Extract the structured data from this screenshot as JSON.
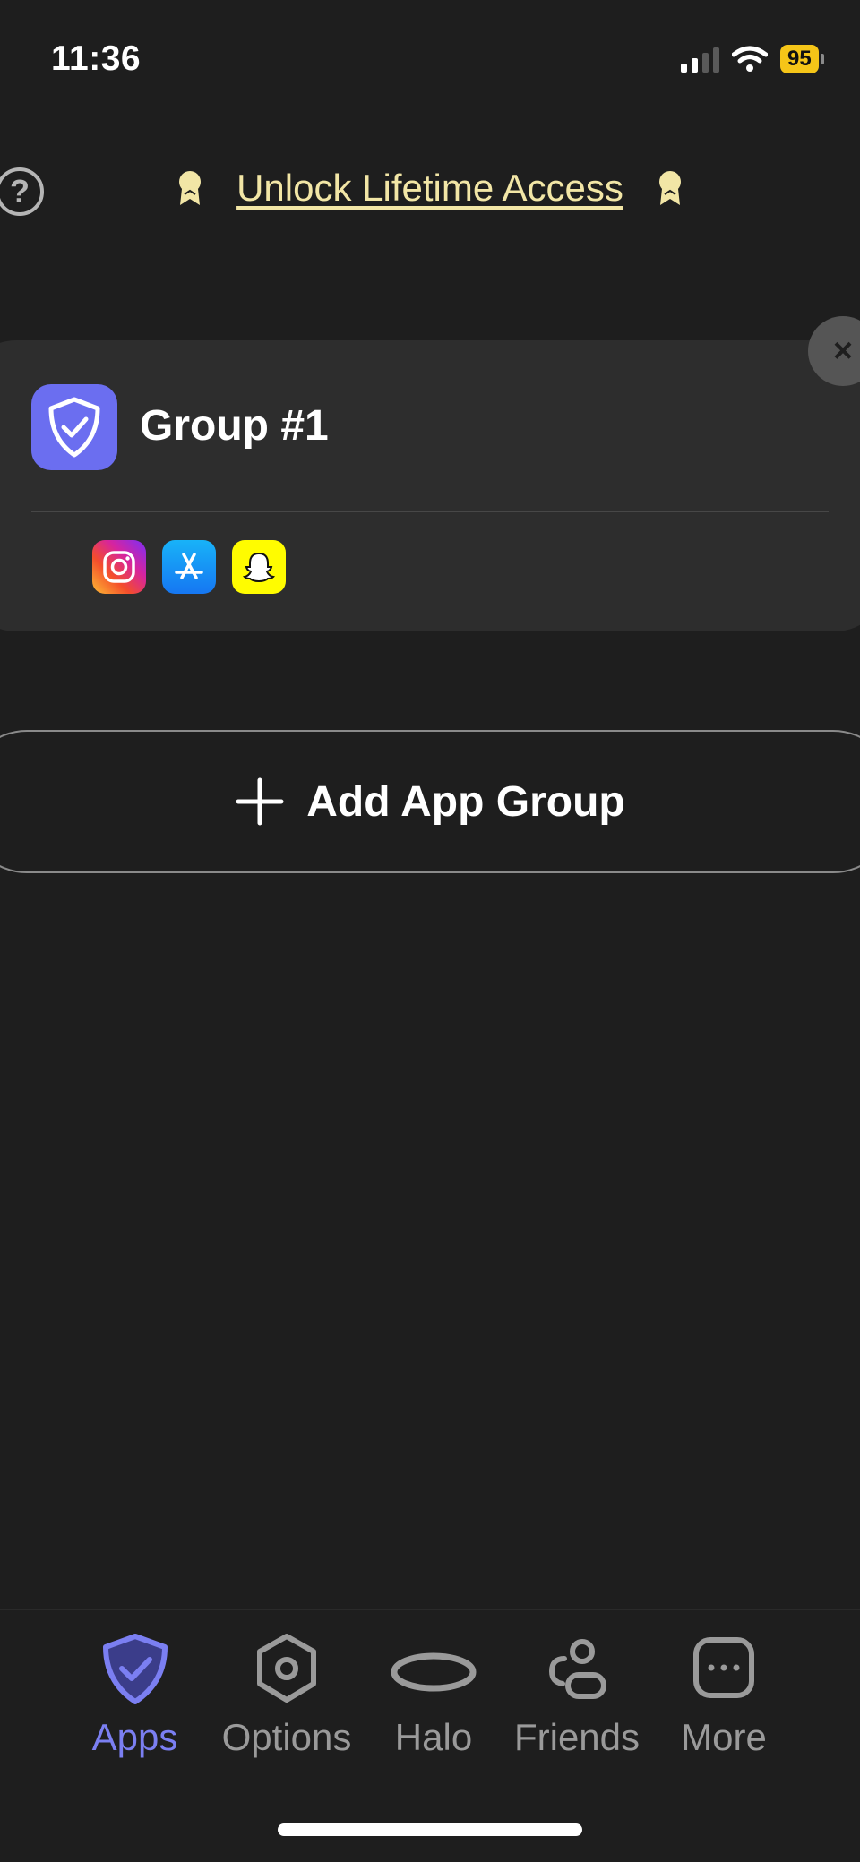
{
  "status_bar": {
    "time": "11:36",
    "battery": "95"
  },
  "promo": {
    "help_symbol": "?",
    "text": "Unlock Lifetime Access",
    "icon": "award-ribbon-icon",
    "color": "#f2e6a6"
  },
  "group": {
    "title": "Group #1",
    "icon": "shield-check-icon",
    "accent": "#6b6ef0",
    "close_symbol": "×",
    "apps": [
      "instagram-icon",
      "app-store-icon",
      "snapchat-icon"
    ]
  },
  "add_group": {
    "label": "Add App Group"
  },
  "tabs": [
    {
      "label": "Apps",
      "icon": "shield-check-icon",
      "active": true
    },
    {
      "label": "Options",
      "icon": "hexagon-options-icon",
      "active": false
    },
    {
      "label": "Halo",
      "icon": "halo-ring-icon",
      "active": false
    },
    {
      "label": "Friends",
      "icon": "friends-icon",
      "active": false
    },
    {
      "label": "More",
      "icon": "more-dots-icon",
      "active": false
    }
  ],
  "colors": {
    "background": "#1e1e1e",
    "card": "#2d2d2d",
    "tab_active": "#7b7ff2",
    "tab_inactive": "#9a9a9a"
  }
}
